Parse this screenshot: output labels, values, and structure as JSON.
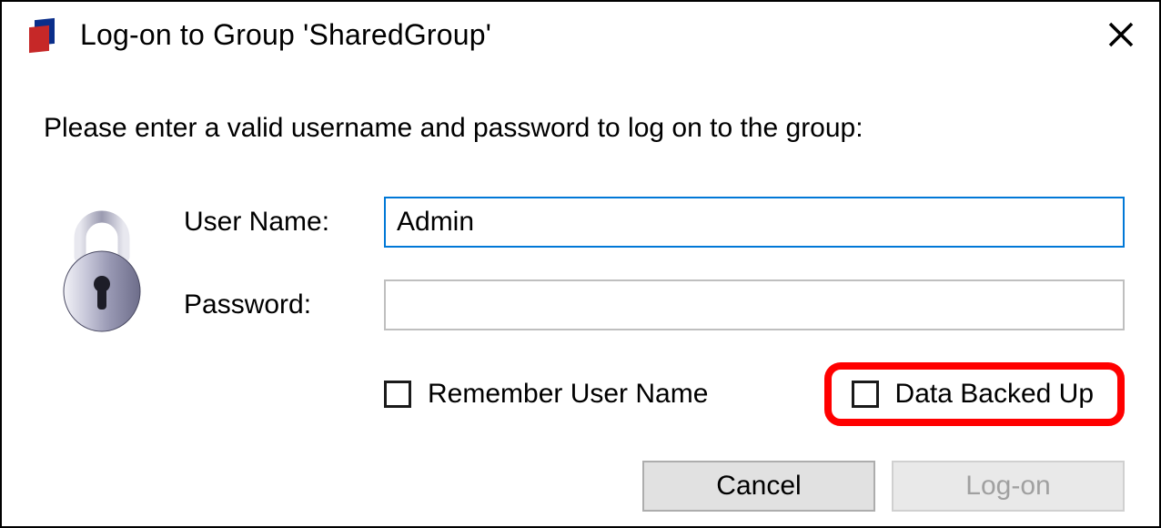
{
  "titlebar": {
    "title": "Log-on to Group 'SharedGroup'"
  },
  "instruction": "Please enter a valid username and password to log on to the group:",
  "form": {
    "username_label": "User Name:",
    "username_value": "Admin",
    "password_label": "Password:",
    "password_value": ""
  },
  "checkboxes": {
    "remember_label": "Remember User Name",
    "remember_checked": false,
    "backedup_label": "Data Backed Up",
    "backedup_checked": false
  },
  "buttons": {
    "cancel": "Cancel",
    "logon": "Log-on",
    "logon_enabled": false
  }
}
